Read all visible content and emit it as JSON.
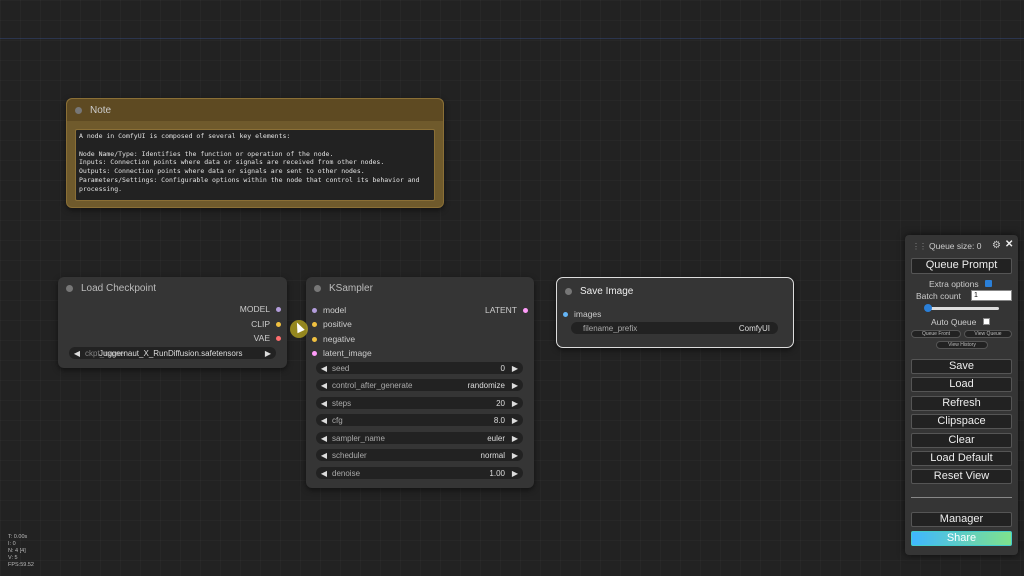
{
  "note": {
    "title": "Note",
    "text": "A node in ComfyUI is composed of several key elements:\n\nNode Name/Type: Identifies the function or operation of the node.\nInputs: Connection points where data or signals are received from other nodes.\nOutputs: Connection points where data or signals are sent to other nodes.\nParameters/Settings: Configurable options within the node that control its behavior and processing."
  },
  "load_checkpoint": {
    "title": "Load Checkpoint",
    "outputs": [
      "MODEL",
      "CLIP",
      "VAE"
    ],
    "ckpt_label": "ckpt_name",
    "ckpt_value": "Juggernaut_X_RunDiffusion.safetensors"
  },
  "ksampler": {
    "title": "KSampler",
    "inputs": [
      "model",
      "positive",
      "negative",
      "latent_image"
    ],
    "output": "LATENT",
    "widgets": [
      {
        "name": "seed",
        "value": "0"
      },
      {
        "name": "control_after_generate",
        "value": "randomize"
      },
      {
        "name": "steps",
        "value": "20"
      },
      {
        "name": "cfg",
        "value": "8.0"
      },
      {
        "name": "sampler_name",
        "value": "euler"
      },
      {
        "name": "scheduler",
        "value": "normal"
      },
      {
        "name": "denoise",
        "value": "1.00"
      }
    ]
  },
  "save_image": {
    "title": "Save Image",
    "input": "images",
    "prefix_label": "filename_prefix",
    "prefix_value": "ComfyUI"
  },
  "stats": {
    "t": "T: 0.00s",
    "i": "I: 0",
    "n": "N: 4 [4]",
    "v": "V: 5",
    "fps": "FPS:59.52"
  },
  "menu": {
    "queue_size": "Queue size: 0",
    "queue_prompt": "Queue Prompt",
    "extra_options": "Extra options",
    "batch_count_label": "Batch count",
    "batch_count_value": "1",
    "auto_queue": "Auto Queue",
    "queue_front": "Queue Front",
    "view_queue": "View Queue",
    "view_history": "View History",
    "save": "Save",
    "load": "Load",
    "refresh": "Refresh",
    "clipspace": "Clipspace",
    "clear": "Clear",
    "load_default": "Load Default",
    "reset_view": "Reset View",
    "manager": "Manager",
    "share": "Share"
  },
  "colors": {
    "model_socket": "#b39ddb",
    "clip_socket": "#f0c040",
    "vae_socket": "#ff6e6e",
    "latent_socket": "#ff9cf9",
    "image_socket": "#64b5f6"
  }
}
